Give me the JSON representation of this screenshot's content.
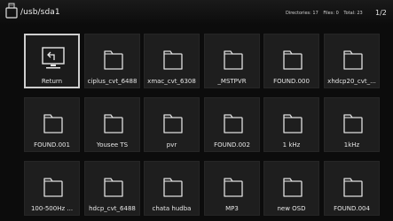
{
  "header": {
    "path": "/usb/sda1",
    "directories": "Directories: 17",
    "files": "Files: 0",
    "total": "Total: 23",
    "page": "1/2"
  },
  "grid": {
    "items": [
      {
        "label": "Return",
        "icon": "return-icon",
        "selected": true
      },
      {
        "label": "ciplus_cvt_6488",
        "icon": "folder-icon"
      },
      {
        "label": "xmac_cvt_6308",
        "icon": "folder-icon"
      },
      {
        "label": "_MSTPVR",
        "icon": "folder-icon"
      },
      {
        "label": "FOUND.000",
        "icon": "folder-icon"
      },
      {
        "label": "xhdcp20_cvt_...",
        "icon": "folder-icon"
      },
      {
        "label": "FOUND.001",
        "icon": "folder-icon"
      },
      {
        "label": "Yousee TS",
        "icon": "folder-icon"
      },
      {
        "label": "pvr",
        "icon": "folder-icon"
      },
      {
        "label": "FOUND.002",
        "icon": "folder-icon"
      },
      {
        "label": "1 kHz",
        "icon": "folder-icon"
      },
      {
        "label": "1kHz",
        "icon": "folder-icon"
      },
      {
        "label": "100-500Hz ...",
        "icon": "folder-icon"
      },
      {
        "label": "hdcp_cvt_6488",
        "icon": "folder-icon"
      },
      {
        "label": "chata hudba",
        "icon": "folder-icon"
      },
      {
        "label": "MP3",
        "icon": "folder-icon"
      },
      {
        "label": "new OSD",
        "icon": "folder-icon"
      },
      {
        "label": "FOUND.004",
        "icon": "folder-icon"
      }
    ]
  },
  "colors": {
    "background": "#0c0c0c",
    "tile": "#1e1e1e",
    "selection_border": "#cfcfcf",
    "text": "#e6e6e6"
  }
}
